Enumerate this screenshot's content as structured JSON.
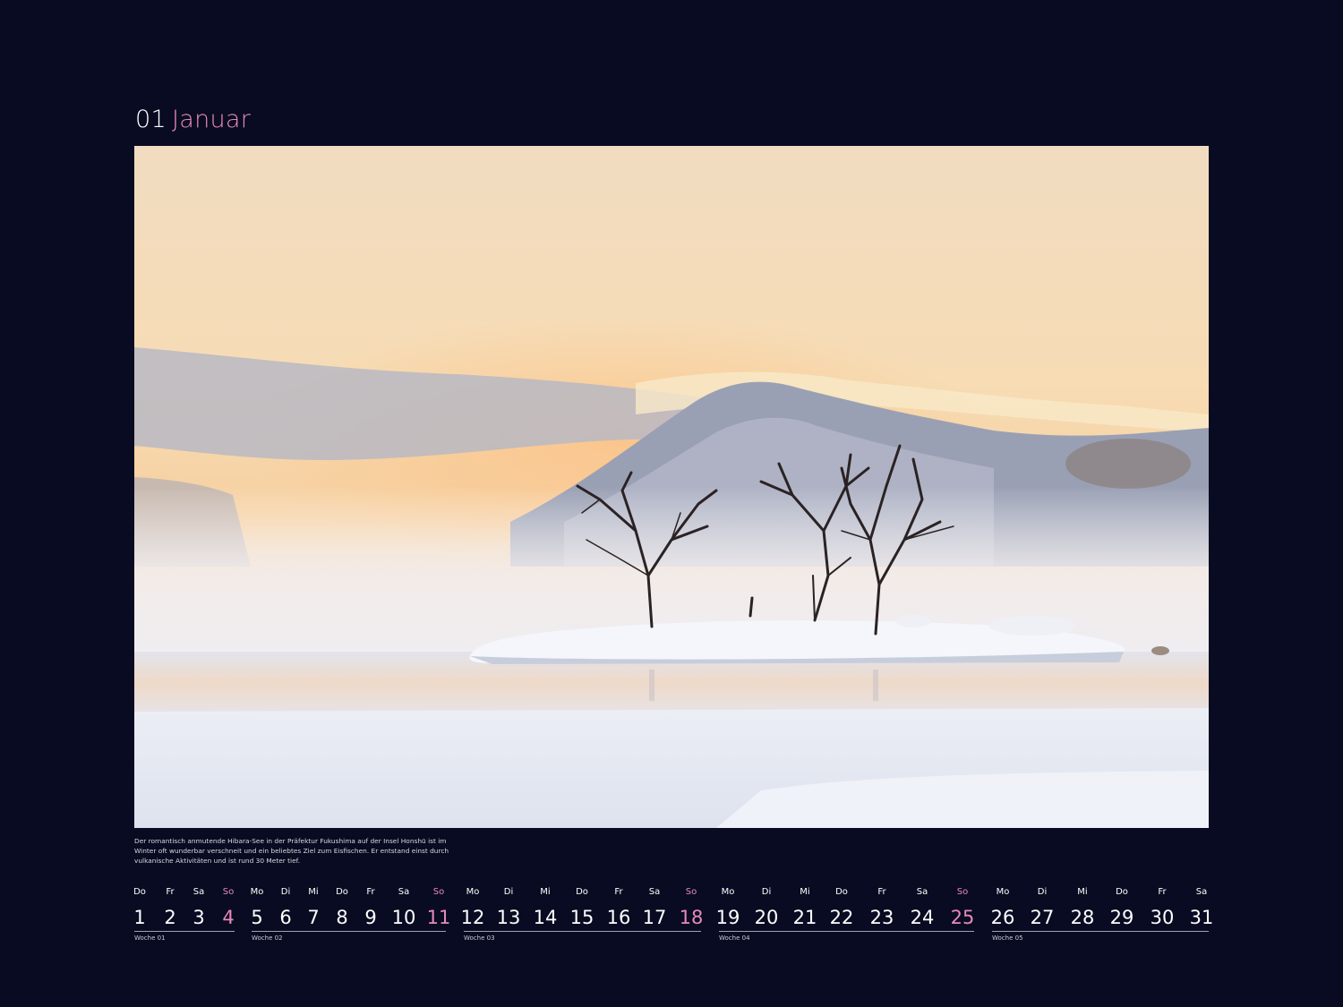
{
  "header": {
    "month_number": "01",
    "month_name": "Januar"
  },
  "caption": "Der romantisch anmutende Hibara-See in der Präfektur Fukushima auf der Insel Honshū ist im Winter oft wunderbar verschneit und ein beliebtes Ziel zum Eisfischen. Er entstand einst durch vulkanische Aktivitäten und ist rund 30 Meter tief.",
  "colors": {
    "background": "#080b21",
    "accent": "#e889bd",
    "text": "#ffffff"
  },
  "weeks": [
    {
      "label": "Woche 01",
      "days": [
        {
          "name": "Do",
          "date": "1",
          "sunday": false
        },
        {
          "name": "Fr",
          "date": "2",
          "sunday": false
        },
        {
          "name": "Sa",
          "date": "3",
          "sunday": false
        },
        {
          "name": "So",
          "date": "4",
          "sunday": true
        }
      ]
    },
    {
      "label": "Woche 02",
      "days": [
        {
          "name": "Mo",
          "date": "5",
          "sunday": false
        },
        {
          "name": "Di",
          "date": "6",
          "sunday": false
        },
        {
          "name": "Mi",
          "date": "7",
          "sunday": false
        },
        {
          "name": "Do",
          "date": "8",
          "sunday": false
        },
        {
          "name": "Fr",
          "date": "9",
          "sunday": false
        },
        {
          "name": "Sa",
          "date": "10",
          "sunday": false
        },
        {
          "name": "So",
          "date": "11",
          "sunday": true
        }
      ]
    },
    {
      "label": "Woche 03",
      "days": [
        {
          "name": "Mo",
          "date": "12",
          "sunday": false
        },
        {
          "name": "Di",
          "date": "13",
          "sunday": false
        },
        {
          "name": "Mi",
          "date": "14",
          "sunday": false
        },
        {
          "name": "Do",
          "date": "15",
          "sunday": false
        },
        {
          "name": "Fr",
          "date": "16",
          "sunday": false
        },
        {
          "name": "Sa",
          "date": "17",
          "sunday": false
        },
        {
          "name": "So",
          "date": "18",
          "sunday": true
        }
      ]
    },
    {
      "label": "Woche 04",
      "days": [
        {
          "name": "Mo",
          "date": "19",
          "sunday": false
        },
        {
          "name": "Di",
          "date": "20",
          "sunday": false
        },
        {
          "name": "Mi",
          "date": "21",
          "sunday": false
        },
        {
          "name": "Do",
          "date": "22",
          "sunday": false
        },
        {
          "name": "Fr",
          "date": "23",
          "sunday": false
        },
        {
          "name": "Sa",
          "date": "24",
          "sunday": false
        },
        {
          "name": "So",
          "date": "25",
          "sunday": true
        }
      ]
    },
    {
      "label": "Woche 05",
      "days": [
        {
          "name": "Mo",
          "date": "26",
          "sunday": false
        },
        {
          "name": "Di",
          "date": "27",
          "sunday": false
        },
        {
          "name": "Mi",
          "date": "28",
          "sunday": false
        },
        {
          "name": "Do",
          "date": "29",
          "sunday": false
        },
        {
          "name": "Fr",
          "date": "30",
          "sunday": false
        },
        {
          "name": "Sa",
          "date": "31",
          "sunday": false
        }
      ]
    }
  ]
}
